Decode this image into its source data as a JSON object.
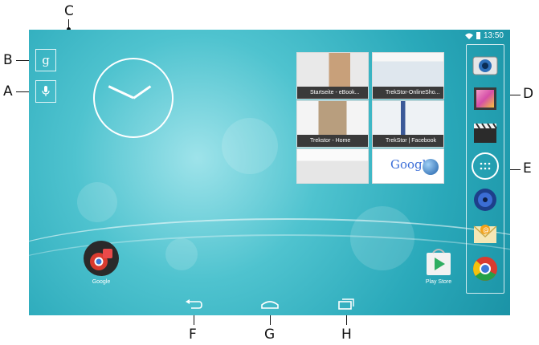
{
  "callouts": {
    "a": "A",
    "b": "B",
    "c": "C",
    "d": "D",
    "e": "E",
    "f": "F",
    "g": "G",
    "h": "H"
  },
  "status_bar": {
    "time": "13:50",
    "icons": [
      "wifi-icon",
      "battery-icon"
    ]
  },
  "search": {
    "google_glyph": "g",
    "icons": [
      "google-search-icon",
      "mic-icon"
    ]
  },
  "recent_tabs": [
    {
      "label": "Startseite - eBook..."
    },
    {
      "label": "TrekStor-OnlineSho..."
    },
    {
      "label": "Trekstor - Home"
    },
    {
      "label": "TrekStor | Facebook"
    },
    {
      "label": ""
    },
    {
      "label": "Google"
    }
  ],
  "dock_icons": [
    "camera-icon",
    "gallery-icon",
    "video-icon",
    "all-apps-icon",
    "music-icon",
    "email-icon",
    "chrome-icon"
  ],
  "home_apps": [
    {
      "label": "Google"
    },
    {
      "label": "Play Store"
    }
  ],
  "nav_icons": [
    "back-icon",
    "home-icon",
    "recent-apps-icon"
  ],
  "colors": {
    "accent": "#2aa9ba",
    "highlight": "#4fc3cf"
  }
}
